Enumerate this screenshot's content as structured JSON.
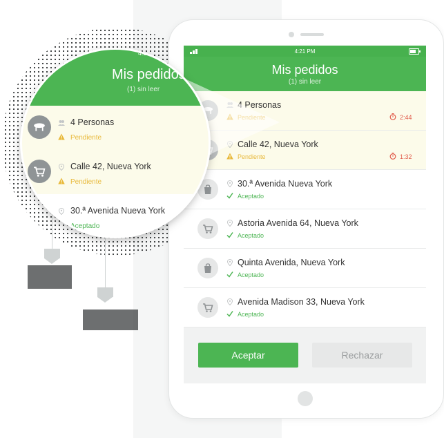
{
  "status_bar": {
    "time": "4:21 PM"
  },
  "header": {
    "title": "Mis pedidos",
    "subtitle": "(1) sin leer"
  },
  "orders": [
    {
      "title": "4 Personas",
      "status": "Pendiente",
      "timer": "2:44",
      "icon": "table-icon"
    },
    {
      "title": "Calle 42, Nueva York",
      "status": "Pendiente",
      "timer": "1:32",
      "icon": "cart-icon"
    },
    {
      "title": "30.ª Avenida Nueva York",
      "status": "Aceptado",
      "icon": "bag-icon"
    },
    {
      "title": "Astoria Avenida 64, Nueva York",
      "status": "Aceptado",
      "icon": "cart-icon"
    },
    {
      "title": "Quinta Avenida, Nueva York",
      "status": "Aceptado",
      "icon": "bag-icon"
    },
    {
      "title": "Avenida Madison 33, Nueva York",
      "status": "Aceptado",
      "icon": "cart-icon"
    }
  ],
  "actions": {
    "accept": "Aceptar",
    "reject": "Rechazar"
  },
  "colors": {
    "accent": "#4cb553",
    "pending": "#e8b93a",
    "timer": "#e15a4a"
  }
}
